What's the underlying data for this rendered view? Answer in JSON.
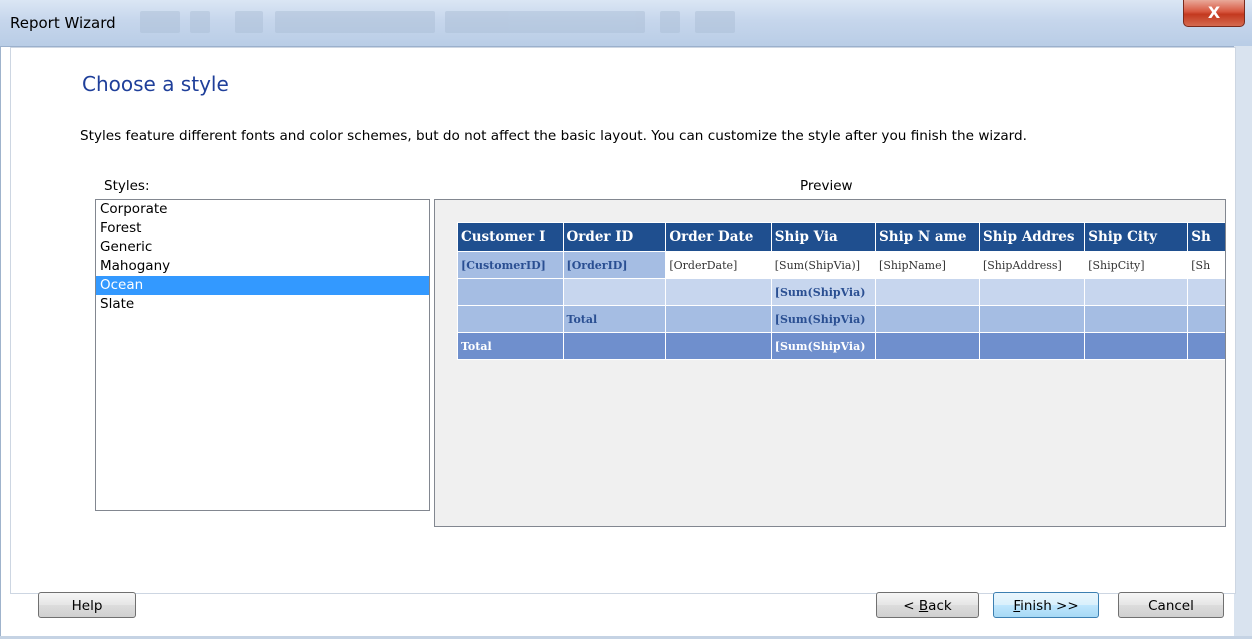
{
  "window": {
    "title": "Report Wizard",
    "close_glyph": "X"
  },
  "page": {
    "heading": "Choose a style",
    "description": "Styles feature different fonts and color schemes, but do not affect the basic layout. You can customize the style after you finish the wizard."
  },
  "styles": {
    "label": "Styles:",
    "items": [
      "Corporate",
      "Forest",
      "Generic",
      "Mahogany",
      "Ocean",
      "Slate"
    ],
    "selected": "Ocean"
  },
  "preview": {
    "label": "Preview",
    "headers": [
      "Customer I",
      "Order ID",
      "Order Date",
      "Ship Via",
      "Ship N ame",
      "Ship Addres",
      "Ship City",
      "Sh"
    ],
    "row1": [
      "[CustomerID]",
      "[OrderID]",
      "[OrderDate]",
      "[Sum(ShipVia)]",
      "[ShipName]",
      "[ShipAddress]",
      "[ShipCity]",
      "[Sh"
    ],
    "row2_value": "[Sum(ShipVia)",
    "row3_label": "Total",
    "row3_value": "[Sum(ShipVia)",
    "row4_label": "Total",
    "row4_value": "[Sum(ShipVia)"
  },
  "buttons": {
    "help": "Help",
    "back": "< Back",
    "back_mnemonic": "B",
    "finish": "Finish >>",
    "finish_mnemonic": "F",
    "cancel": "Cancel"
  },
  "colors": {
    "heading": "#1f3f9a",
    "selection": "#3399ff",
    "table_header": "#1f4f8f",
    "table_group": "#a5bde3",
    "table_total": "#6f8fcd"
  }
}
